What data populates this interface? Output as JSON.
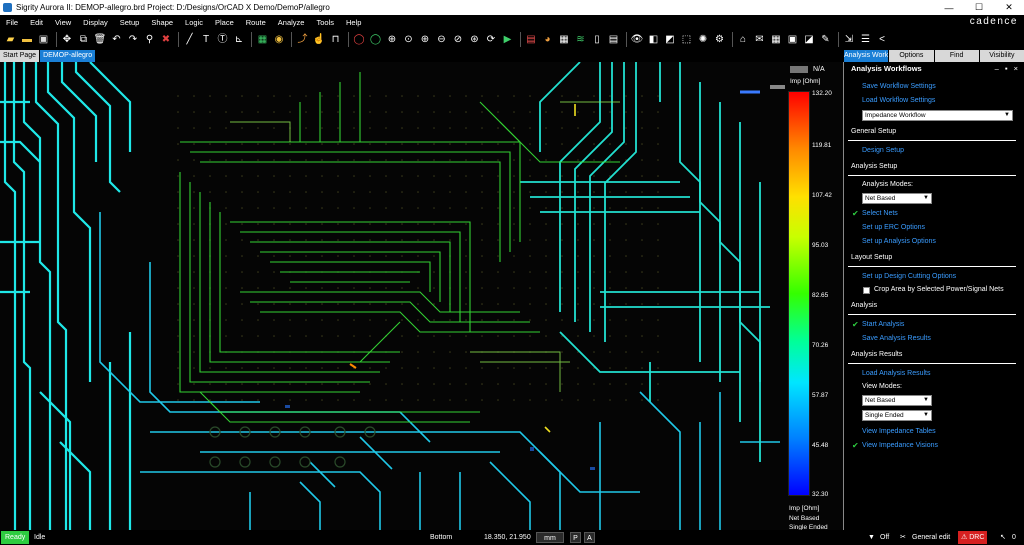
{
  "window": {
    "title": "Sigrity Aurora II: DEMOP-allegro.brd  Project: D:/Designs/OrCAD X Demo/DemoP/allegro",
    "min_btn": "—",
    "max_btn": "☐",
    "close_btn": "✕"
  },
  "menu": [
    "File",
    "Edit",
    "View",
    "Display",
    "Setup",
    "Shape",
    "Logic",
    "Place",
    "Route",
    "Analyze",
    "Tools",
    "Help"
  ],
  "brand": "cadence",
  "tabs": [
    {
      "label": "Start Page",
      "active": false
    },
    {
      "label": "DEMOP-allegro",
      "active": true
    }
  ],
  "legend": {
    "na_label": "N/A",
    "unit_top": "Imp [Ohm]",
    "ticks": [
      "132.20",
      "119.81",
      "107.42",
      "95.03",
      "82.65",
      "70.26",
      "57.87",
      "45.48",
      "32.30"
    ],
    "unit_bottom": "Imp [Ohm]",
    "mode_1": "Net Based",
    "mode_2": "Single Ended"
  },
  "panel_tabs": [
    {
      "label": "Analysis Workflo...",
      "active": true
    },
    {
      "label": "Options",
      "active": false
    },
    {
      "label": "Find",
      "active": false
    },
    {
      "label": "Visibility",
      "active": false
    }
  ],
  "panel": {
    "header": "Analysis Workflows",
    "header_controls": "– ▪ ×",
    "save_workflow": "Save Workflow Settings",
    "load_workflow": "Load Workflow Settings",
    "workflow_select": "Impedance Workflow",
    "general_setup": "General Setup",
    "design_setup": "Design Setup",
    "analysis_setup": "Analysis Setup",
    "analysis_modes_label": "Analysis Modes:",
    "analysis_mode_select": "Net Based",
    "select_nets": "Select Nets",
    "setup_erc": "Set up ERC Options",
    "setup_analysis": "Set up Analysis Options",
    "layout_setup": "Layout Setup",
    "design_cutting": "Set up Design Cutting Options",
    "crop_area": "Crop Area by Selected Power/Signal Nets",
    "analysis": "Analysis",
    "start_analysis": "Start Analysis",
    "save_results": "Save Analysis Results",
    "analysis_results": "Analysis Results",
    "load_results": "Load Analysis Results",
    "view_modes_label": "View Modes:",
    "view_mode_select": "Net Based",
    "view_type_select": "Single Ended",
    "view_tables": "View Impedance Tables",
    "view_visions": "View Impedance Visions"
  },
  "status": {
    "ready": "Ready",
    "idle": "Idle",
    "layer": "Bottom",
    "coords": "18.350, 21.950",
    "units": "mm",
    "p": "P",
    "a": "A",
    "filter_icon": "▼",
    "filter_state": "Off",
    "mode": "General edit",
    "drc": "DRC",
    "pointer_count": "0"
  }
}
